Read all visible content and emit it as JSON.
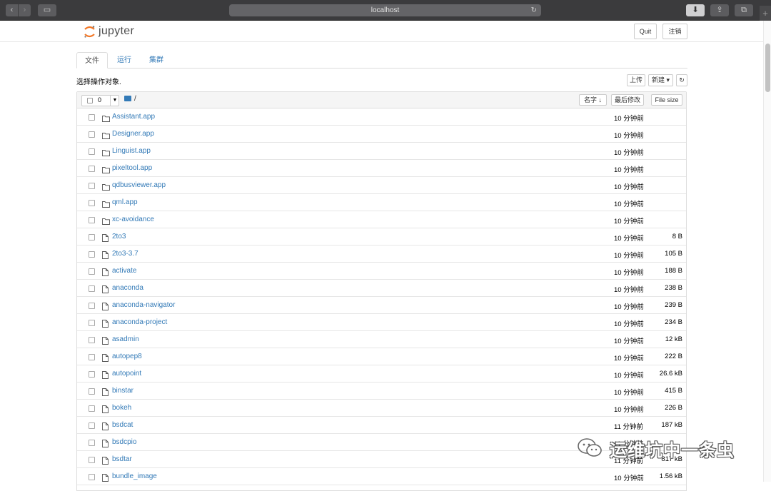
{
  "browser": {
    "url": "localhost"
  },
  "header": {
    "logo_text": "jupyter",
    "quit_label": "Quit",
    "logout_label": "注销"
  },
  "tabs": [
    {
      "label": "文件"
    },
    {
      "label": "运行"
    },
    {
      "label": "集群"
    }
  ],
  "toolbar": {
    "select_hint": "选择操作对象.",
    "upload_label": "上传",
    "new_label": "新建 ▾",
    "refresh_icon": "refresh-icon"
  },
  "list_header": {
    "selected_count": "0",
    "breadcrumb": "/",
    "sort_name": "名字 ↓",
    "sort_modified": "最后修改",
    "sort_size": "File size"
  },
  "files": [
    {
      "name": "Assistant.app",
      "type": "folder",
      "modified": "10 分钟前",
      "size": ""
    },
    {
      "name": "Designer.app",
      "type": "folder",
      "modified": "10 分钟前",
      "size": ""
    },
    {
      "name": "Linguist.app",
      "type": "folder",
      "modified": "10 分钟前",
      "size": ""
    },
    {
      "name": "pixeltool.app",
      "type": "folder",
      "modified": "10 分钟前",
      "size": ""
    },
    {
      "name": "qdbusviewer.app",
      "type": "folder",
      "modified": "10 分钟前",
      "size": ""
    },
    {
      "name": "qml.app",
      "type": "folder",
      "modified": "10 分钟前",
      "size": ""
    },
    {
      "name": "xc-avoidance",
      "type": "folder",
      "modified": "10 分钟前",
      "size": ""
    },
    {
      "name": "2to3",
      "type": "file",
      "modified": "10 分钟前",
      "size": "8 B"
    },
    {
      "name": "2to3-3.7",
      "type": "file",
      "modified": "10 分钟前",
      "size": "105 B"
    },
    {
      "name": "activate",
      "type": "file",
      "modified": "10 分钟前",
      "size": "188 B"
    },
    {
      "name": "anaconda",
      "type": "file",
      "modified": "10 分钟前",
      "size": "238 B"
    },
    {
      "name": "anaconda-navigator",
      "type": "file",
      "modified": "10 分钟前",
      "size": "239 B"
    },
    {
      "name": "anaconda-project",
      "type": "file",
      "modified": "10 分钟前",
      "size": "234 B"
    },
    {
      "name": "asadmin",
      "type": "file",
      "modified": "10 分钟前",
      "size": "12 kB"
    },
    {
      "name": "autopep8",
      "type": "file",
      "modified": "10 分钟前",
      "size": "222 B"
    },
    {
      "name": "autopoint",
      "type": "file",
      "modified": "10 分钟前",
      "size": "26.6 kB"
    },
    {
      "name": "binstar",
      "type": "file",
      "modified": "10 分钟前",
      "size": "415 B"
    },
    {
      "name": "bokeh",
      "type": "file",
      "modified": "10 分钟前",
      "size": "226 B"
    },
    {
      "name": "bsdcat",
      "type": "file",
      "modified": "11 分钟前",
      "size": "187 kB"
    },
    {
      "name": "bsdcpio",
      "type": "file",
      "modified": "11 分钟前",
      "size": ""
    },
    {
      "name": "bsdtar",
      "type": "file",
      "modified": "11 分钟前",
      "size": "817 kB"
    },
    {
      "name": "bundle_image",
      "type": "file",
      "modified": "10 分钟前",
      "size": "1.56 kB"
    }
  ],
  "watermark": {
    "text": "运维坑中一条虫"
  },
  "colors": {
    "link": "#337ab7",
    "jupyter_orange": "#f37726"
  }
}
